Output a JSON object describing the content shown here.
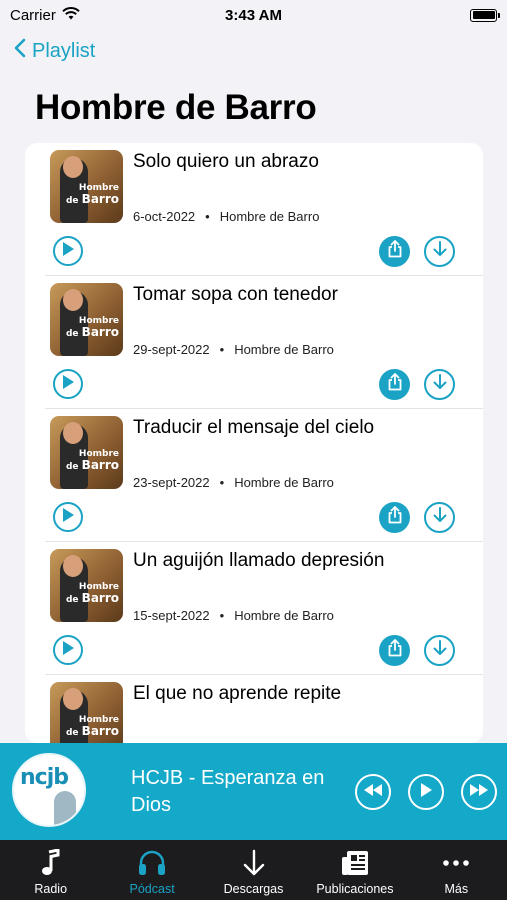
{
  "status_bar": {
    "carrier": "Carrier",
    "time": "3:43 AM"
  },
  "nav": {
    "back_label": "Playlist",
    "title": "Hombre de Barro"
  },
  "thumbnail": {
    "line1": "Hombre",
    "line2": "de",
    "line3": "Barro"
  },
  "episodes": [
    {
      "title": "Solo quiero un abrazo",
      "date": "6-oct-2022",
      "show": "Hombre de Barro"
    },
    {
      "title": "Tomar sopa con tenedor",
      "date": "29-sept-2022",
      "show": "Hombre de Barro"
    },
    {
      "title": "Traducir el mensaje del cielo",
      "date": "23-sept-2022",
      "show": "Hombre de Barro"
    },
    {
      "title": "Un aguijón llamado depresión",
      "date": "15-sept-2022",
      "show": "Hombre de Barro"
    },
    {
      "title": "El que no aprende repite",
      "date": "",
      "show": ""
    }
  ],
  "now_playing": {
    "logo": "ncjb",
    "title": "HCJB - Esperanza en Dios"
  },
  "tabs": [
    {
      "label": "Radio",
      "icon": "music-note-icon"
    },
    {
      "label": "Pódcast",
      "icon": "headphones-icon"
    },
    {
      "label": "Descargas",
      "icon": "download-arrow-icon"
    },
    {
      "label": "Publicaciones",
      "icon": "newspaper-icon"
    },
    {
      "label": "Más",
      "icon": "more-dots-icon"
    }
  ],
  "colors": {
    "accent": "#1aa3c4",
    "now_playing_bg": "#14a8c9",
    "tab_bar_bg": "#1c1c1e"
  }
}
